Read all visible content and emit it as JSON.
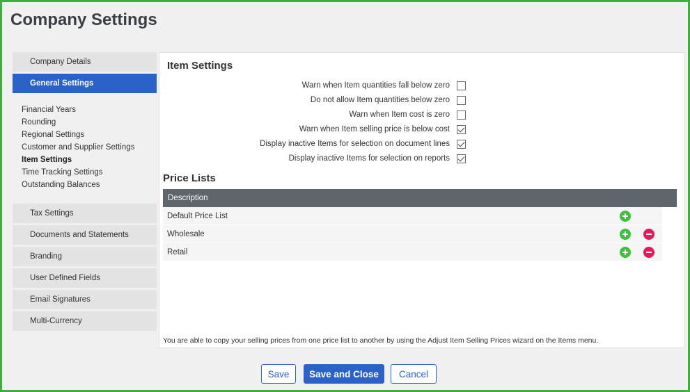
{
  "page_title": "Company Settings",
  "sidebar": {
    "top_items": [
      {
        "label": "Company Details"
      },
      {
        "label": "General Settings"
      }
    ],
    "sub_items": [
      {
        "label": "Financial Years"
      },
      {
        "label": "Rounding"
      },
      {
        "label": "Regional Settings"
      },
      {
        "label": "Customer and Supplier Settings"
      },
      {
        "label": "Item Settings"
      },
      {
        "label": "Time Tracking Settings"
      },
      {
        "label": "Outstanding Balances"
      }
    ],
    "bottom_items": [
      {
        "label": "Tax Settings"
      },
      {
        "label": "Documents and Statements"
      },
      {
        "label": "Branding"
      },
      {
        "label": "User Defined Fields"
      },
      {
        "label": "Email Signatures"
      },
      {
        "label": "Multi-Currency"
      }
    ]
  },
  "item_settings": {
    "title": "Item Settings",
    "options": [
      {
        "label": "Warn when Item quantities fall below zero",
        "checked": false
      },
      {
        "label": "Do not allow Item quantities below zero",
        "checked": false
      },
      {
        "label": "Warn when Item cost is zero",
        "checked": false
      },
      {
        "label": "Warn when Item selling price is below cost",
        "checked": true
      },
      {
        "label": "Display inactive Items for selection on document lines",
        "checked": true
      },
      {
        "label": "Display inactive Items for selection on reports",
        "checked": true
      }
    ]
  },
  "price_lists": {
    "title": "Price Lists",
    "header": "Description",
    "rows": [
      {
        "name": "Default Price List",
        "add": true,
        "remove": false
      },
      {
        "name": "Wholesale",
        "add": true,
        "remove": true
      },
      {
        "name": "Retail",
        "add": true,
        "remove": true
      }
    ],
    "footnote": "You are able to copy your selling prices from one price list to another by using the Adjust Item Selling Prices wizard on the Items menu."
  },
  "buttons": {
    "save": "Save",
    "save_close": "Save and Close",
    "cancel": "Cancel"
  },
  "colors": {
    "accent": "#2a62c9",
    "add": "#3cc13c",
    "remove": "#e4185a",
    "frame": "#3fae3f"
  }
}
